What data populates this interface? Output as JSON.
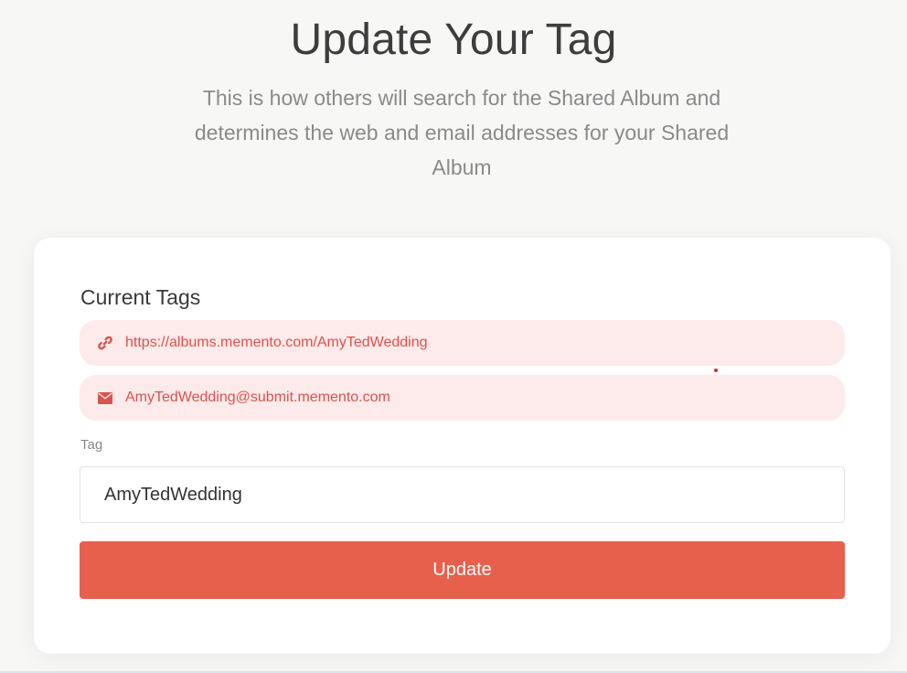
{
  "header": {
    "title": "Update Your Tag",
    "subtitle": "This is how others will search for the Shared Album and determines the web and email addresses for your Shared Album"
  },
  "card": {
    "section_label": "Current Tags",
    "current_tags": [
      {
        "icon": "link-icon",
        "text": "https://albums.memento.com/AmyTedWedding"
      },
      {
        "icon": "envelope-icon",
        "text": "AmyTedWedding@submit.memento.com"
      }
    ],
    "tag_field": {
      "label": "Tag",
      "value": "AmyTedWedding"
    },
    "update_button": "Update"
  },
  "colors": {
    "accent": "#e7604c",
    "pill_background": "#fdeaea",
    "pill_text": "#d9534f"
  }
}
